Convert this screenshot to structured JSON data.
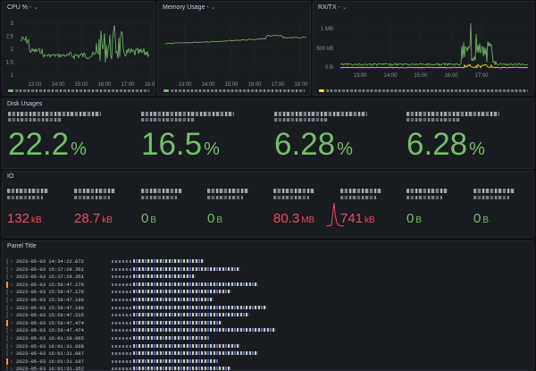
{
  "cpu": {
    "title": "CPU % -",
    "y_ticks": [
      "3",
      "2.5",
      "2",
      "1.5",
      "1"
    ],
    "x_ticks": [
      "13:00",
      "14:00",
      "15:00",
      "16:00",
      "17:00",
      "18:00"
    ]
  },
  "memory": {
    "title": "Memory Usage -",
    "x_ticks": [
      "13:00",
      "14:00",
      "15:00",
      "16:00",
      "17:00",
      "18:00"
    ]
  },
  "rxtx": {
    "title": "RX/TX -",
    "y_ticks": [
      "1 MB",
      "500 kB",
      "0 B"
    ],
    "x_ticks": [
      "13:00",
      "14:00",
      "15:00",
      "16:00",
      "17:00"
    ]
  },
  "disk": {
    "title": "Disk Usages",
    "stats": [
      {
        "value": "22.2",
        "unit": "%"
      },
      {
        "value": "16.5",
        "unit": "%"
      },
      {
        "value": "6.28",
        "unit": "%"
      },
      {
        "value": "6.28",
        "unit": "%"
      }
    ]
  },
  "io": {
    "title": "IO",
    "stats": [
      {
        "value": "132",
        "unit": "kB",
        "color": "#f2495c"
      },
      {
        "value": "28.7",
        "unit": "kB",
        "color": "#f2495c"
      },
      {
        "value": "0",
        "unit": "B",
        "color": "#73bf69"
      },
      {
        "value": "0",
        "unit": "B",
        "color": "#73bf69"
      },
      {
        "value": "80.3",
        "unit": "MB",
        "color": "#f2495c"
      },
      {
        "value": "741",
        "unit": "kB",
        "color": "#f2495c"
      },
      {
        "value": "0",
        "unit": "B",
        "color": "#73bf69"
      },
      {
        "value": "0",
        "unit": "B",
        "color": "#73bf69"
      }
    ]
  },
  "logs": {
    "title": "Panel Title",
    "rows": [
      {
        "ts": "2023-05-03 14:34:22.072",
        "level": "info"
      },
      {
        "ts": "2023-05-03 15:17:29.351",
        "level": "info"
      },
      {
        "ts": "2023-05-03 15:17:29.351",
        "level": "info"
      },
      {
        "ts": "2023-05-03 15:58:47.176",
        "level": "warn"
      },
      {
        "ts": "2023-05-03 15:58:47.176",
        "level": "info"
      },
      {
        "ts": "2023-05-03 15:58:47.196",
        "level": "info"
      },
      {
        "ts": "2023-05-03 15:58:47.196",
        "level": "info"
      },
      {
        "ts": "2023-05-03 15:58:47.215",
        "level": "info"
      },
      {
        "ts": "2023-05-03 15:58:47.474",
        "level": "warn"
      },
      {
        "ts": "2023-05-03 15:58:47.474",
        "level": "info"
      },
      {
        "ts": "2023-05-03 16:01:29.865",
        "level": "info"
      },
      {
        "ts": "2023-05-03 16:01:31.068",
        "level": "info"
      },
      {
        "ts": "2023-05-03 16:01:31.087",
        "level": "info"
      },
      {
        "ts": "2023-05-03 16:01:31.107",
        "level": "warn"
      },
      {
        "ts": "2023-05-03 16:01:31.352",
        "level": "info"
      }
    ]
  },
  "colors": {
    "background": "#111217",
    "panel": "#181b1f",
    "green": "#73bf69",
    "red": "#f2495c",
    "yellow": "#fade2a",
    "orange": "#ff9830"
  },
  "icons": {
    "panel_menu": "chevron-down-icon",
    "log_expand": "chevron-right-icon"
  }
}
